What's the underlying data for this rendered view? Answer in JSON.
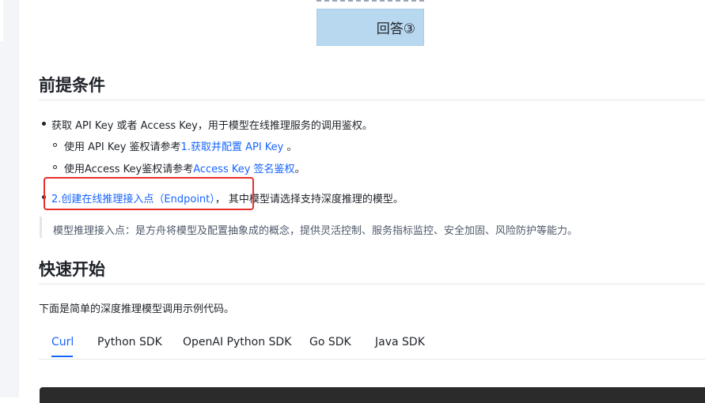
{
  "diagram": {
    "answer_label": "回答③"
  },
  "prereq": {
    "title": "前提条件",
    "item1_text": "获取 API Key 或者 Access Key，用于模型在线推理服务的调用鉴权。",
    "sub1_prefix": "使用 API Key 鉴权请参考",
    "sub1_link": "1.获取并配置 API Key",
    "sub1_suffix": " 。",
    "sub2_prefix": "使用Access Key鉴权请参考",
    "sub2_link": "Access Key 签名鉴权",
    "sub2_suffix": "。",
    "item2_link": "2.创建在线推理接入点（Endpoint）",
    "item2_suffix": "， 其中模型请选择支持深度推理的模型。",
    "note": "模型推理接入点：是方舟将模型及配置抽象成的概念，提供灵活控制、服务指标监控、安全加固、风险防护等能力。"
  },
  "quickstart": {
    "title": "快速开始",
    "intro": "下面是简单的深度推理模型调用示例代码。",
    "tabs": [
      "Curl",
      "Python SDK",
      "OpenAI Python SDK",
      "Go SDK",
      "Java SDK"
    ],
    "active_tab": "Curl"
  },
  "colors": {
    "link": "#1664ff",
    "highlight": "#e8302c",
    "diagram_box": "#b8d8f0"
  }
}
